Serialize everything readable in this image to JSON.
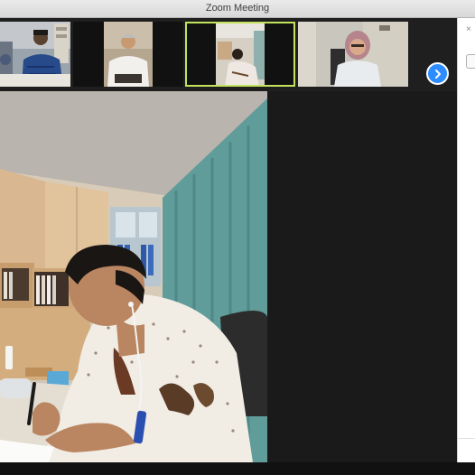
{
  "window": {
    "title": "Zoom Meeting"
  },
  "gallery": {
    "thumbnails": [
      {
        "id": 1,
        "active": false
      },
      {
        "id": 2,
        "active": false
      },
      {
        "id": 3,
        "active": false
      },
      {
        "id": 4,
        "active": true
      },
      {
        "id": 5,
        "active": false
      }
    ],
    "next_icon": "chevron-right-icon"
  },
  "main_video": {
    "speaker": "active-speaker-video"
  },
  "colors": {
    "accent_blue": "#2d8cff",
    "active_speaker_border": "#c2e35b",
    "background": "#1a1a1a",
    "titlebar": "#e2e2e2"
  }
}
